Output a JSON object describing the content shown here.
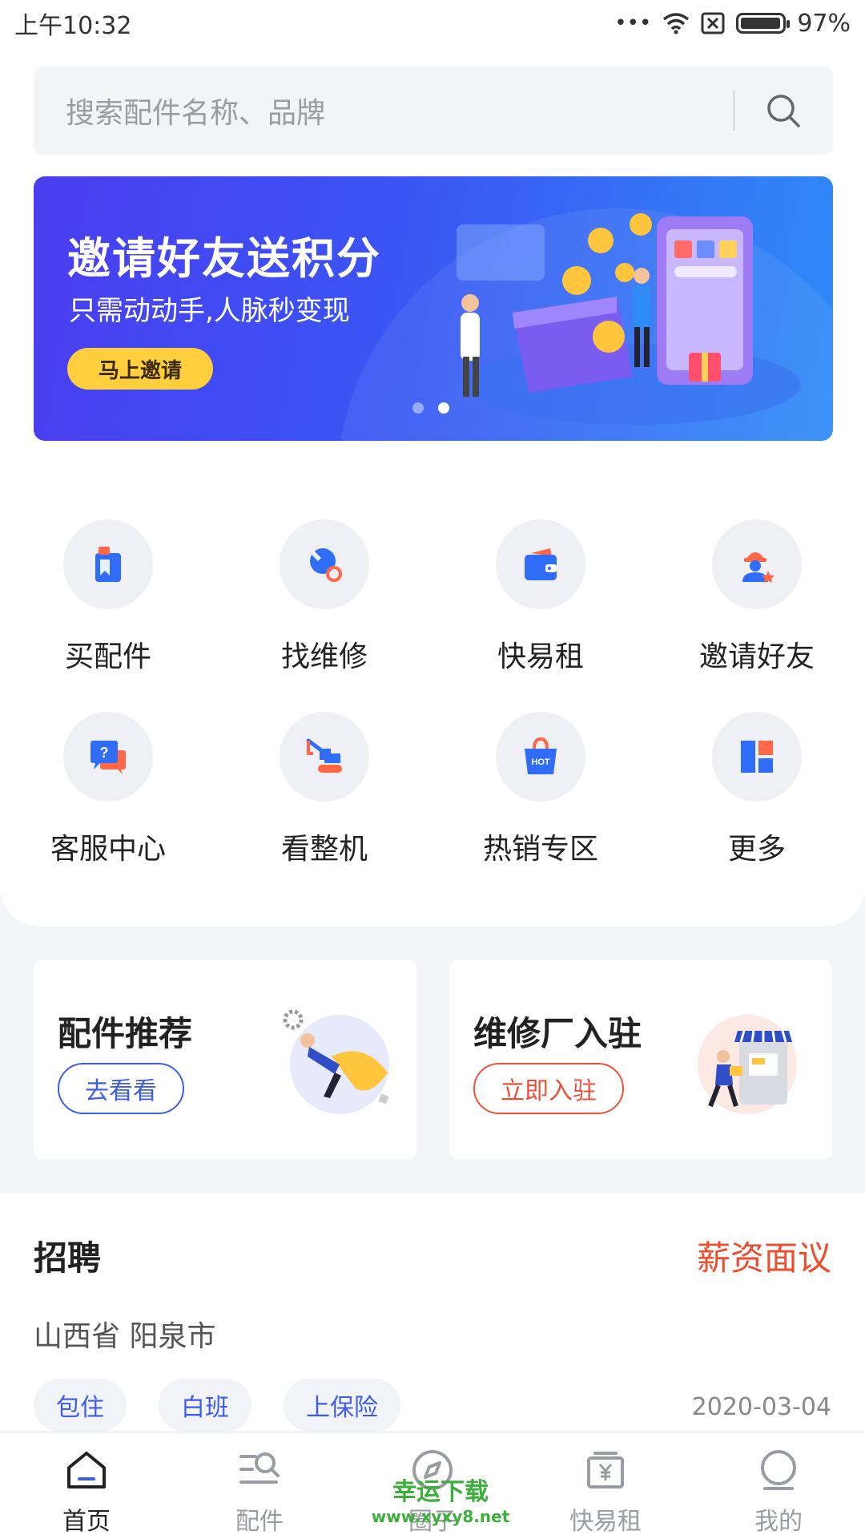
{
  "status_bar": {
    "time": "上午10:32",
    "signal_dots": "•••",
    "battery": "97%",
    "battery_level": 0.97
  },
  "search": {
    "placeholder": "搜索配件名称、品牌",
    "icon": "search-icon"
  },
  "banner": {
    "title": "邀请好友送积分",
    "subtitle": "只需动动手,人脉秒变现",
    "button": "马上邀请",
    "page_count": 2,
    "active_page": 2
  },
  "grid": [
    {
      "label": "买配件",
      "icon": "bottle-icon"
    },
    {
      "label": "找维修",
      "icon": "wrench-icon"
    },
    {
      "label": "快易租",
      "icon": "wallet-icon"
    },
    {
      "label": "邀请好友",
      "icon": "worker-star-icon"
    },
    {
      "label": "客服中心",
      "icon": "chat-question-icon"
    },
    {
      "label": "看整机",
      "icon": "excavator-icon"
    },
    {
      "label": "热销专区",
      "icon": "hot-bag-icon",
      "badge": "HOT"
    },
    {
      "label": "更多",
      "icon": "blocks-icon"
    }
  ],
  "promos": [
    {
      "title": "配件推荐",
      "button": "去看看",
      "color": "#3d5ce8"
    },
    {
      "title": "维修厂入驻",
      "button": "立即入驻",
      "color": "#e8523a"
    }
  ],
  "job": {
    "title": "招聘",
    "salary": "薪资面议",
    "location": "山西省 阳泉市",
    "tags": [
      "包住",
      "白班",
      "上保险"
    ],
    "date": "2020-03-04"
  },
  "bottom_nav": [
    {
      "label": "首页",
      "icon": "home-icon",
      "active": true
    },
    {
      "label": "配件",
      "icon": "parts-search-icon",
      "active": false
    },
    {
      "label": "圈子",
      "icon": "compass-icon",
      "active": false
    },
    {
      "label": "快易租",
      "icon": "yen-box-icon",
      "active": false
    },
    {
      "label": "我的",
      "icon": "profile-icon",
      "active": false
    }
  ],
  "watermark": {
    "line1": "幸运下载",
    "line2": "www.xyxy8.net"
  },
  "colors": {
    "brand_blue": "#3d5ce8",
    "accent_red": "#ee4d2d",
    "banner_yellow": "#ffcf3d"
  }
}
